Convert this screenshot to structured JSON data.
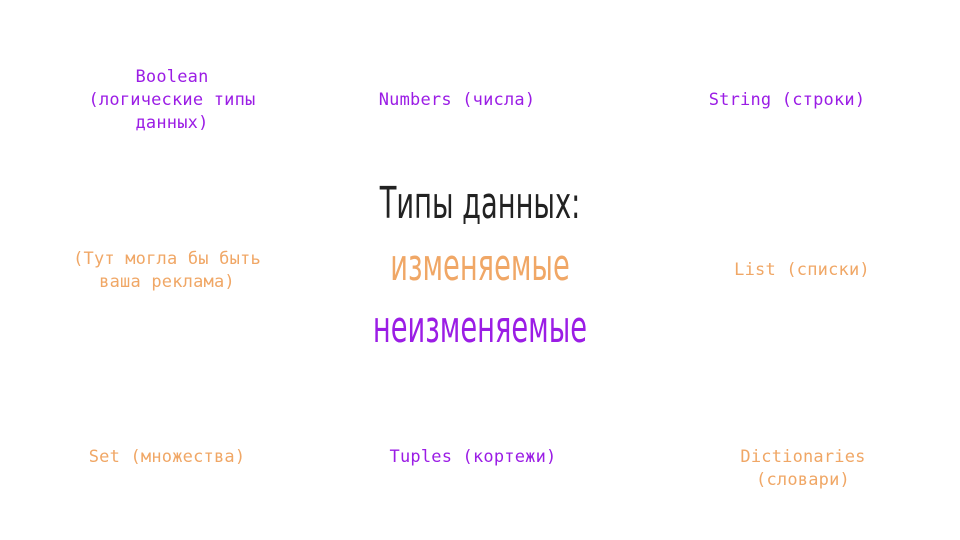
{
  "items": {
    "boolean": "Boolean\n(логические типы\nданных)",
    "numbers": "Numbers (числа)",
    "string": "String (строки)",
    "ad": "(Тут могла бы быть\nваша реклама)",
    "list": "List (списки)",
    "set": "Set (множества)",
    "tuples": "Tuples (кортежи)",
    "dictionaries": "Dictionaries\n(словари)"
  },
  "center": {
    "title": "Типы данных:",
    "mutable": "изменяемые",
    "immutable": "неизменяемые"
  },
  "colors": {
    "purple": "#9b1de5",
    "orange": "#f0a766",
    "dark": "#222222"
  }
}
